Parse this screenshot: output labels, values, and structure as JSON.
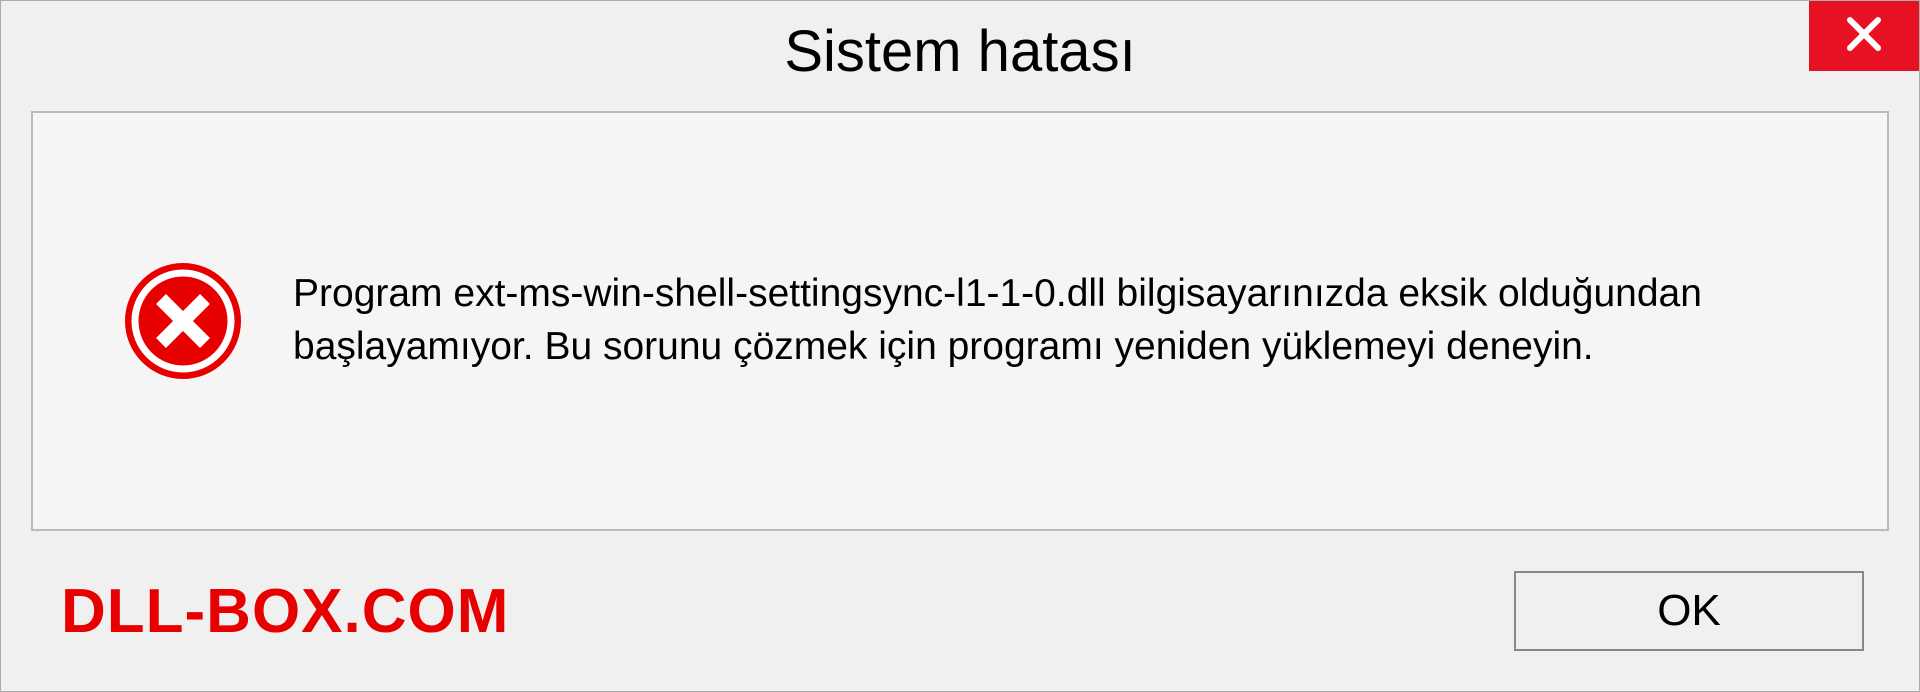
{
  "dialog": {
    "title": "Sistem hatası",
    "message": "Program ext-ms-win-shell-settingsync-l1-1-0.dll bilgisayarınızda eksik olduğundan başlayamıyor. Bu sorunu çözmek için programı yeniden yüklemeyi deneyin.",
    "ok_label": "OK",
    "watermark": "DLL-BOX.COM"
  },
  "colors": {
    "error_red": "#e60000",
    "close_red": "#e81123",
    "panel_bg": "#f5f5f5",
    "dialog_bg": "#f0f0f0"
  }
}
